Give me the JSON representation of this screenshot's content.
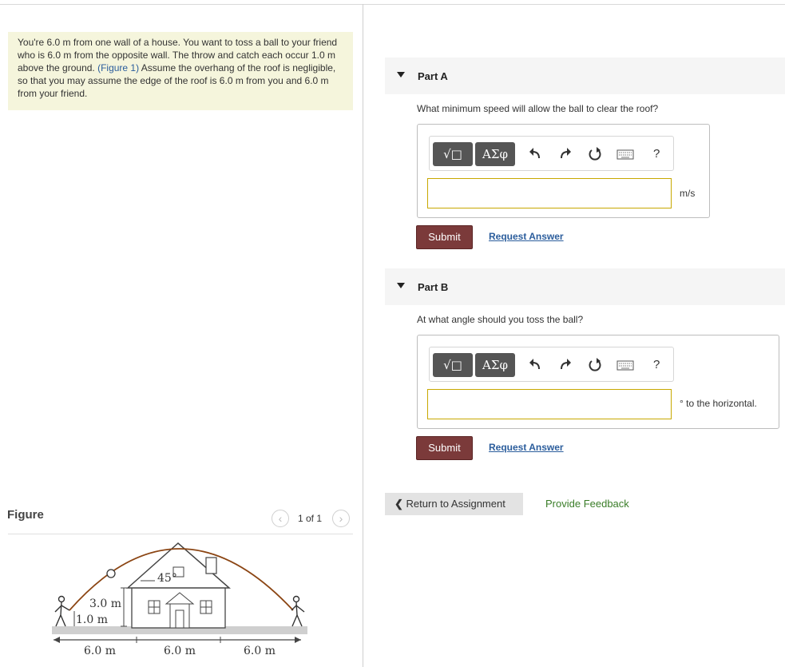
{
  "problem": {
    "text_before": "You're 6.0 m from one wall of a house. You want to toss a ball to your friend who is 6.0 m from the opposite wall. The throw and catch each occur 1.0 m above the ground. ",
    "figure_link": "(Figure 1)",
    "text_after": " Assume the overhang of the roof is negligible, so that you may assume the edge of the roof is 6.0 m from you and 6.0 m from your friend."
  },
  "figure": {
    "title": "Figure",
    "pager": "1 of 1",
    "prev_icon": "chevron-left-icon",
    "next_icon": "chevron-right-icon",
    "labels": {
      "angle": "45°",
      "wall_height": "3.0 m",
      "throw_height": "1.0 m",
      "dist_left": "6.0 m",
      "dist_middle": "6.0 m",
      "dist_right": "6.0 m"
    }
  },
  "toolbar": {
    "sqrt_label": "√□",
    "greek_label": "ΑΣφ",
    "undo_icon": "undo-icon",
    "redo_icon": "redo-icon",
    "reset_icon": "reset-icon",
    "keyboard_icon": "keyboard-icon",
    "help_label": "?"
  },
  "parts": [
    {
      "title": "Part A",
      "question": "What minimum speed will allow the ball to clear the roof?",
      "input_value": "",
      "unit": "m/s",
      "submit_label": "Submit",
      "request_label": "Request Answer"
    },
    {
      "title": "Part B",
      "question": "At what angle should you toss the ball?",
      "input_value": "",
      "unit": "° to the horizontal.",
      "submit_label": "Submit",
      "request_label": "Request Answer"
    }
  ],
  "footer": {
    "return_label": "Return to Assignment",
    "return_icon": "chevron-left-icon",
    "feedback_label": "Provide Feedback"
  },
  "colors": {
    "problem_bg": "#f5f5dc",
    "submit_bg": "#7b3a3a",
    "link": "#2b5d9c",
    "feedback": "#3a7d28",
    "input_border": "#c8a800"
  }
}
